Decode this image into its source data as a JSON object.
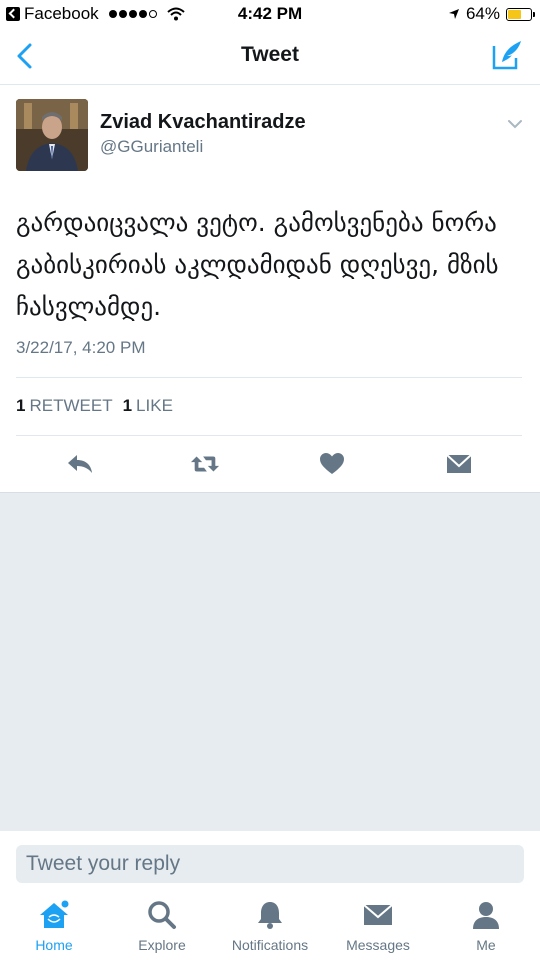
{
  "status_bar": {
    "back_app_label": "Facebook",
    "time": "4:42 PM",
    "battery_percent": "64%",
    "battery_level": 0.64
  },
  "nav": {
    "title": "Tweet",
    "back_icon": "chevron-left-icon",
    "compose_icon": "compose-tweet-icon"
  },
  "tweet": {
    "author_name": "Zviad Kvachantiradze",
    "author_handle": "@GGurianteli",
    "text": "გარდაიცვალა ვეტო. გამოსვენება ნორა გაბისკირიას აკლდამიდან დღესვე, მზის ჩასვლამდე.",
    "timestamp": "3/22/17, 4:20 PM",
    "retweet_count": "1",
    "retweet_label": "RETWEET",
    "like_count": "1",
    "like_label": "LIKE"
  },
  "reply": {
    "placeholder": "Tweet your reply"
  },
  "tabs": [
    {
      "label": "Home",
      "icon": "home-icon",
      "active": true
    },
    {
      "label": "Explore",
      "icon": "search-icon",
      "active": false
    },
    {
      "label": "Notifications",
      "icon": "bell-icon",
      "active": false
    },
    {
      "label": "Messages",
      "icon": "envelope-icon",
      "active": false
    },
    {
      "label": "Me",
      "icon": "person-icon",
      "active": false
    }
  ],
  "colors": {
    "accent": "#1da1f2",
    "action_icon": "#657786",
    "text_primary": "#14171a",
    "text_secondary": "#657786",
    "background_grey": "#e6ecf0",
    "battery": "#f5c518"
  }
}
